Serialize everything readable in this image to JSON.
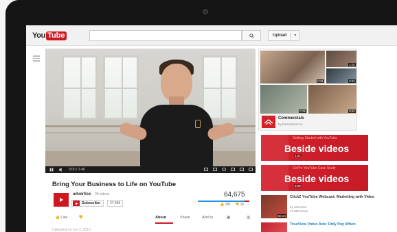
{
  "header": {
    "logo_you": "You",
    "logo_tube": "Tube",
    "search_placeholder": "",
    "upload_label": "Upload"
  },
  "player": {
    "time": "0:00 / 1:46",
    "progress": 0
  },
  "video": {
    "title": "Bring Your Business to Life on YouTube",
    "channel": "advertise",
    "channel_videos": "99 videos",
    "subscribe_label": "Subscribe",
    "subscriber_count": "27,666",
    "views": "64,675",
    "likes": "181",
    "dislikes": "16",
    "like_ratio": 0.91,
    "info_line": "Uploaded on Jun 2, 2013"
  },
  "actions": {
    "like": "Like",
    "about": "About",
    "share": "Share",
    "add_to": "Add to"
  },
  "promo": {
    "title": "Commercials",
    "subtitle": "by bankofamerica",
    "durations": [
      "0:31",
      "1:01",
      "0:31",
      "0:31",
      "0:31"
    ]
  },
  "beside_ads": [
    {
      "top_text": "Getting Started with YouTube",
      "main_text": "Beside videos",
      "duration": "1:21"
    },
    {
      "top_text": "GoPro YouTube Case Study",
      "main_text": "Beside videos",
      "duration": "3:08"
    }
  ],
  "side_videos": [
    {
      "title": "ClickZ YouTube Webcast: Marketing with Video",
      "by": "by advertise",
      "views": "13,856 views",
      "duration": "58:24"
    },
    {
      "title": "TrueView Video Ads: Only Pay When",
      "by": "",
      "views": "",
      "duration": ""
    }
  ],
  "colors": {
    "youtube_red": "#cc181e",
    "link_blue": "#167ac6",
    "like_blue": "#2793e6"
  }
}
